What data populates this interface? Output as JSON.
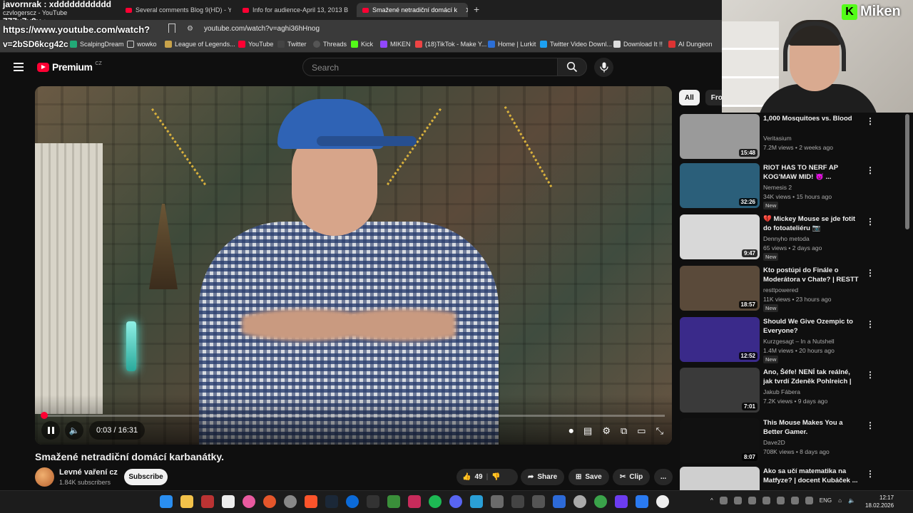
{
  "chat": {
    "line1": "javornrak : xddddddddddd",
    "line2": "czvlogerscz - YouTube",
    "user": "777x7y8y :"
  },
  "tabs": [
    {
      "label": "Several comments Blog 9(HD) - YouT"
    },
    {
      "label": "Info for audience-April 13, 2013 Blog"
    },
    {
      "label": "Smažené netradiční domácí k"
    }
  ],
  "overlay_url": "https://www.youtube.com/watch?",
  "overlay_user": "v=2bSD6kcg42c",
  "address": {
    "url": "youtube.com/watch?v=aghi36hHnog"
  },
  "bookmarks": [
    "ScalpingDream",
    "wowko",
    "League of Legends...",
    "YouTube",
    "Twitter",
    "Threads",
    "Kick",
    "MIKEN",
    "(18)TikTok - Make Y...",
    "Home | Lurkit",
    "Twitter Video Downl...",
    "Download It !!",
    "AI Dungeon"
  ],
  "header": {
    "logo": "Premium",
    "region": "CZ",
    "search_placeholder": "Search"
  },
  "player": {
    "time": "0:03 / 16:31",
    "progress": 0.003
  },
  "video": {
    "title": "Smažené netradiční domácí karbanátky.",
    "channel": "Levné vaření cz",
    "subs": "1.84K subscribers",
    "subscribe": "Subscribe",
    "likes": "49",
    "share": "Share",
    "save": "Save",
    "clip": "Clip",
    "more": "..."
  },
  "chips": [
    "All",
    "From"
  ],
  "recommendations": [
    {
      "title": "1,000 Mosquitoes vs. Blood",
      "channel": "Veritasium",
      "meta": "7.2M views • 2 weeks ago",
      "duration": "15:48",
      "new": "",
      "color": "#9a9a9a"
    },
    {
      "title": "RIOT HAS TO NERF AP KOG'MAW MID! 👿 ...",
      "channel": "Nemesis 2",
      "meta": "34K views • 15 hours ago",
      "duration": "32:26",
      "new": "New",
      "color": "#2b5f7a"
    },
    {
      "title": "💔 Mickey Mouse se jde fotit do fotoateliéru 📷",
      "channel": "Dennyho metoda",
      "meta": "65 views • 2 days ago",
      "duration": "9:47",
      "new": "New",
      "color": "#d8d8d8"
    },
    {
      "title": "Kto postúpi do Finále o Moderátora v Chate? | RESTT",
      "channel": "resttpowered",
      "meta": "11K views • 23 hours ago",
      "duration": "18:57",
      "new": "New",
      "color": "#5a4a3a"
    },
    {
      "title": "Should We Give Ozempic to Everyone?",
      "channel": "Kurzgesagt – In a Nutshell",
      "meta": "1.4M views • 20 hours ago",
      "duration": "12:52",
      "new": "New",
      "color": "#3a2a8a"
    },
    {
      "title": "Ano, Šéfe! NENÍ tak reálné, jak tvrdí Zdeněk Pohlreich | Co ta...",
      "channel": "Jakub Fábera",
      "meta": "7.2K views • 9 days ago",
      "duration": "7:01",
      "new": "",
      "color": "#3a3a3a"
    },
    {
      "title": "This Mouse Makes You a Better Gamer.",
      "channel": "Dave2D",
      "meta": "708K views • 8 days ago",
      "duration": "8:07",
      "new": "",
      "color": "#111111"
    },
    {
      "title": "Ako sa učí matematika na Matfyze? | docent Kubáček ...",
      "channel": "",
      "meta": "",
      "duration": "",
      "new": "",
      "color": "#cfcfcf"
    }
  ],
  "webcam": {
    "brand": "Miken"
  },
  "taskbar": {
    "lang": "ENG",
    "time": "12:17",
    "date": "18.02.2026"
  }
}
